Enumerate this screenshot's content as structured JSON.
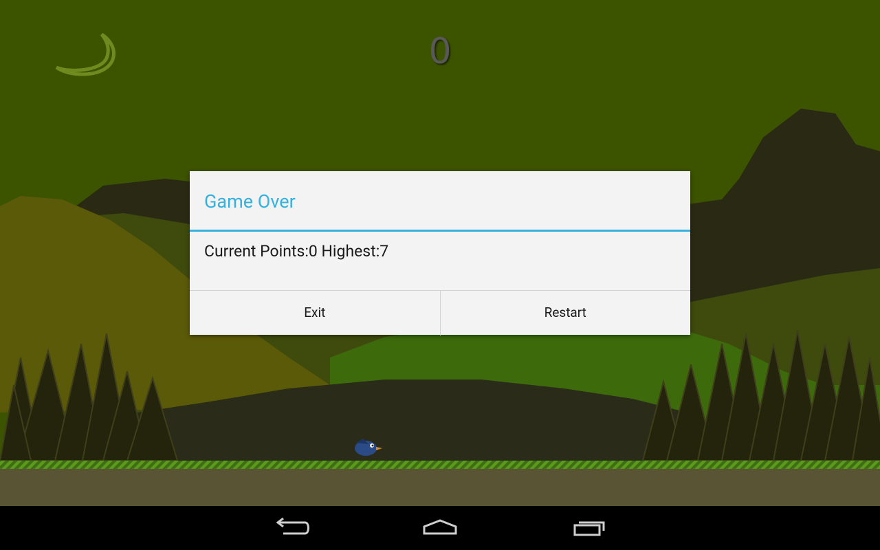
{
  "game": {
    "score": "0"
  },
  "dialog": {
    "title": "Game Over",
    "message": "Current Points:0 Highest:7",
    "buttons": {
      "exit": "Exit",
      "restart": "Restart"
    }
  },
  "navbar": {
    "back": "back-icon",
    "home": "home-icon",
    "recents": "recents-icon"
  },
  "colors": {
    "sky": "#3c5300",
    "accent": "#35b1df",
    "dialog_bg": "#f3f3f3"
  }
}
